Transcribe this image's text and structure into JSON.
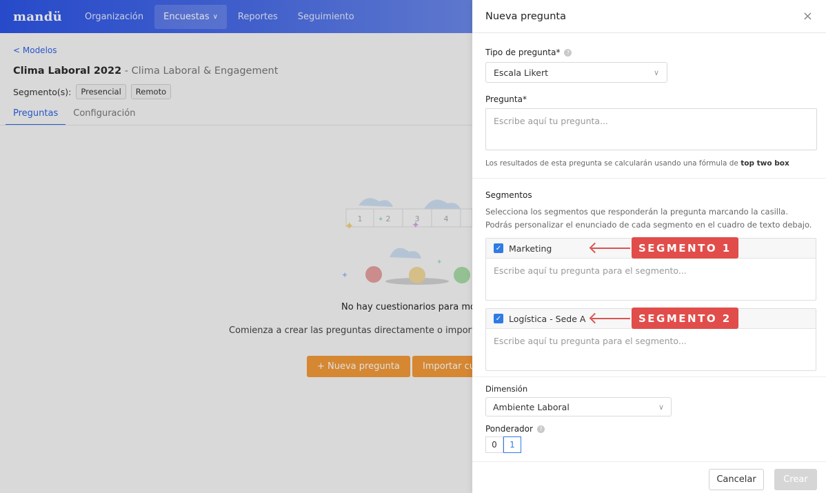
{
  "nav": {
    "logo": "mandü",
    "items": [
      {
        "label": "Organización"
      },
      {
        "label": "Encuestas",
        "chevron": "∨"
      },
      {
        "label": "Reportes"
      },
      {
        "label": "Seguimiento"
      }
    ]
  },
  "page": {
    "back_link": "< Modelos",
    "title": "Clima Laboral 2022",
    "subtitle": " - Clima Laboral & Engagement",
    "segments_label": "Segmento(s):",
    "segments": [
      "Presencial",
      "Remoto"
    ],
    "tabs": [
      "Preguntas",
      "Configuración"
    ],
    "illustration_scale": [
      "1",
      "2",
      "3",
      "4"
    ],
    "empty_title": "No hay cuestionarios para most",
    "empty_sub": "Comienza a crear las preguntas directamente o importa un a",
    "new_question_button": "+ Nueva pregunta",
    "import_button": "Importar cue"
  },
  "drawer": {
    "title": "Nueva pregunta",
    "close_icon": "×",
    "type_label": "Tipo de pregunta*",
    "help_icon": "?",
    "type_value": "Escala Likert",
    "question_label": "Pregunta*",
    "question_placeholder": "Escribe aquí tu pregunta...",
    "hint_prefix": "Los resultados de esta pregunta se calcularán usando una fórmula de ",
    "hint_bold": "top two box",
    "segments_title": "Segmentos",
    "segments_desc": "Selecciona los segmentos que responderán la pregunta marcando la casilla. Podrás personalizar el enunciado de cada segmento en el cuadro de texto debajo.",
    "segments": [
      {
        "name": "Marketing",
        "checked": true,
        "placeholder": "Escribe aquí tu pregunta para el segmento...",
        "tag": "SEGMENTO 1"
      },
      {
        "name": "Logística - Sede A",
        "checked": true,
        "placeholder": "Escribe aquí tu pregunta para el segmento...",
        "tag": "SEGMENTO 2"
      }
    ],
    "dimension_label": "Dimensión",
    "dimension_value": "Ambiente Laboral",
    "weight_label": "Ponderador",
    "weight_options": [
      "0",
      "1"
    ],
    "weight_selected": "1",
    "cancel_button": "Cancelar",
    "create_button": "Crear"
  },
  "colors": {
    "brand_blue": "#2d55e6",
    "link_blue": "#2f62e4",
    "orange": "#f39a3a",
    "annotation_red": "#e14d4a",
    "checkbox_blue": "#2f7be6"
  }
}
